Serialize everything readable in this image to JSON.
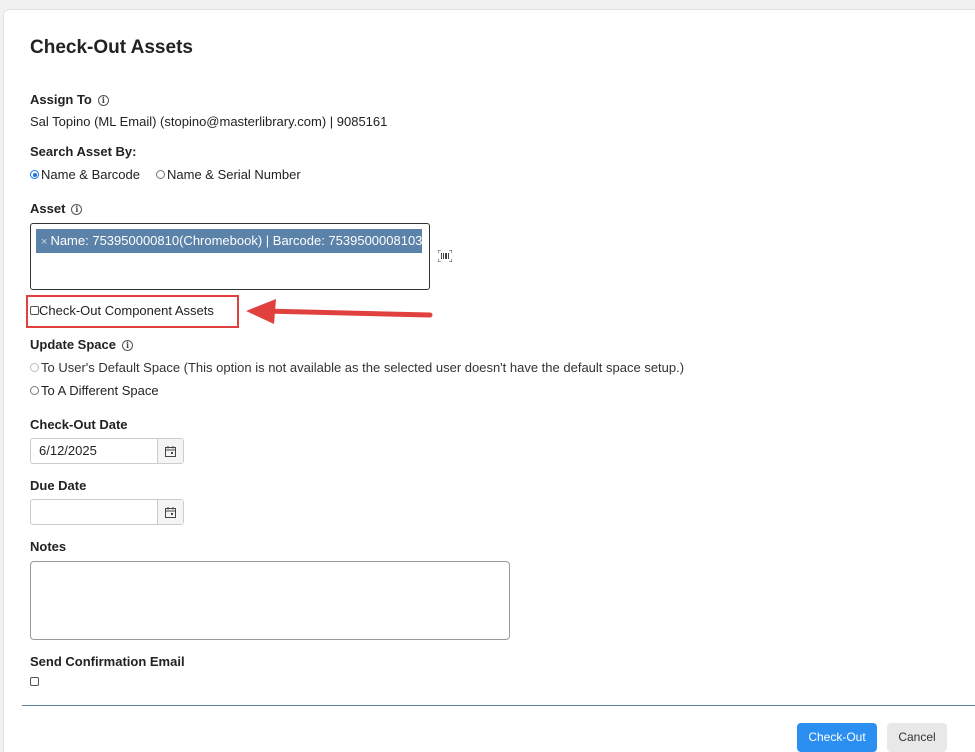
{
  "modal": {
    "title": "Check-Out Assets"
  },
  "assign_to": {
    "label": "Assign To",
    "value": "Sal Topino (ML Email) (stopino@masterlibrary.com) | 9085161"
  },
  "search_by": {
    "label": "Search Asset By:",
    "options": [
      {
        "label": "Name & Barcode",
        "checked": true
      },
      {
        "label": "Name & Serial Number",
        "checked": false
      }
    ]
  },
  "asset": {
    "label": "Asset",
    "chip_remove": "×",
    "chip_text": "Name: 753950000810(Chromebook) | Barcode: 7539500008103"
  },
  "component": {
    "label": "Check-Out Component Assets",
    "checked": false
  },
  "update_space": {
    "label": "Update Space",
    "options": [
      {
        "label": "To User's Default Space (This option is not available as the selected user doesn't have the default space setup.)",
        "disabled": true
      },
      {
        "label": "To A Different Space",
        "disabled": false
      }
    ]
  },
  "checkout_date": {
    "label": "Check-Out Date",
    "value": "6/12/2025"
  },
  "due_date": {
    "label": "Due Date",
    "value": ""
  },
  "notes": {
    "label": "Notes",
    "value": ""
  },
  "confirmation_email": {
    "label": "Send Confirmation Email",
    "checked": false
  },
  "footer": {
    "checkout_label": "Check-Out",
    "cancel_label": "Cancel"
  },
  "colors": {
    "annotation_red": "#e0413e",
    "primary_button": "#2b8ff2",
    "chip_background": "#5b82a8"
  }
}
